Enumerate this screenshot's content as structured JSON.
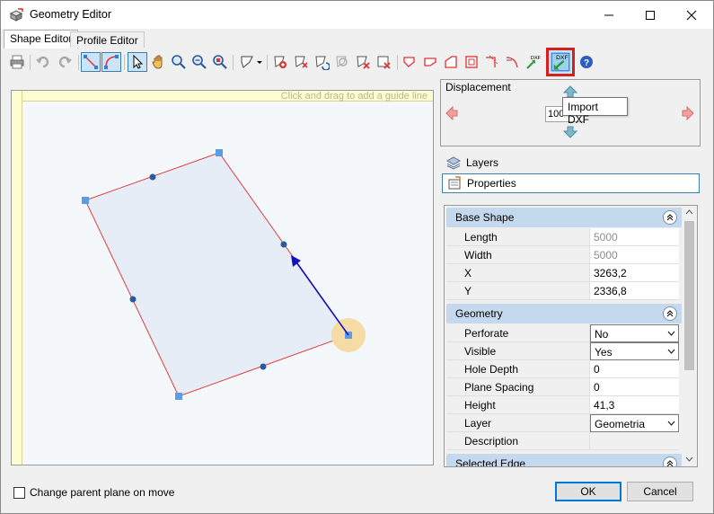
{
  "window": {
    "title": "Geometry Editor"
  },
  "tabs": [
    {
      "label": "Shape Editor",
      "active": true
    },
    {
      "label": "Profile Editor",
      "active": false
    }
  ],
  "toolbar": {
    "tooltip": "Import DXF",
    "dxf_badge": "DXF",
    "icons": [
      "print-icon",
      "undo-icon",
      "redo-icon",
      "draw-line-icon",
      "draw-arc-icon",
      "select-icon",
      "pan-icon",
      "zoom-in-icon",
      "zoom-out-icon",
      "zoom-fit-icon",
      "shape-dropdown-icon",
      "add-vertex-icon",
      "add-point-icon",
      "rotate-icon",
      "merge-icon",
      "delete-vertex-icon",
      "delete-icon",
      "flip-icon",
      "flag-icon",
      "notch-icon",
      "chamfer-icon",
      "cut-corner-icon",
      "round-corner-icon",
      "export-dxf-icon",
      "import-dxf-icon",
      "help-icon"
    ]
  },
  "canvas": {
    "guide_hint": "Click and drag to add a guide line"
  },
  "displacement": {
    "label": "Displacement",
    "value": "100"
  },
  "panels": [
    {
      "label": "Layers",
      "selected": false
    },
    {
      "label": "Properties",
      "selected": true
    }
  ],
  "properties": {
    "base_shape": {
      "title": "Base Shape",
      "rows": [
        {
          "name": "Length",
          "value": "5000",
          "readonly": true
        },
        {
          "name": "Width",
          "value": "5000",
          "readonly": true
        },
        {
          "name": "X",
          "value": "3263,2"
        },
        {
          "name": "Y",
          "value": "2336,8"
        }
      ]
    },
    "geometry": {
      "title": "Geometry",
      "rows": [
        {
          "name": "Perforate",
          "value": "No",
          "combo": true
        },
        {
          "name": "Visible",
          "value": "Yes",
          "combo": true
        },
        {
          "name": "Hole Depth",
          "value": "0"
        },
        {
          "name": "Plane Spacing",
          "value": "0"
        },
        {
          "name": "Height",
          "value": "41,3"
        },
        {
          "name": "Layer",
          "value": "Geometria",
          "combo": true
        },
        {
          "name": "Description",
          "value": ""
        }
      ]
    },
    "selected_edge": {
      "title": "Selected Edge"
    }
  },
  "footer": {
    "checkbox_label": "Change parent plane on move",
    "ok": "OK",
    "cancel": "Cancel"
  },
  "colors": {
    "accent": "#0078d7",
    "highlight": "#d62020",
    "shape_edge": "#e04040",
    "arrow": "#1010c0"
  }
}
